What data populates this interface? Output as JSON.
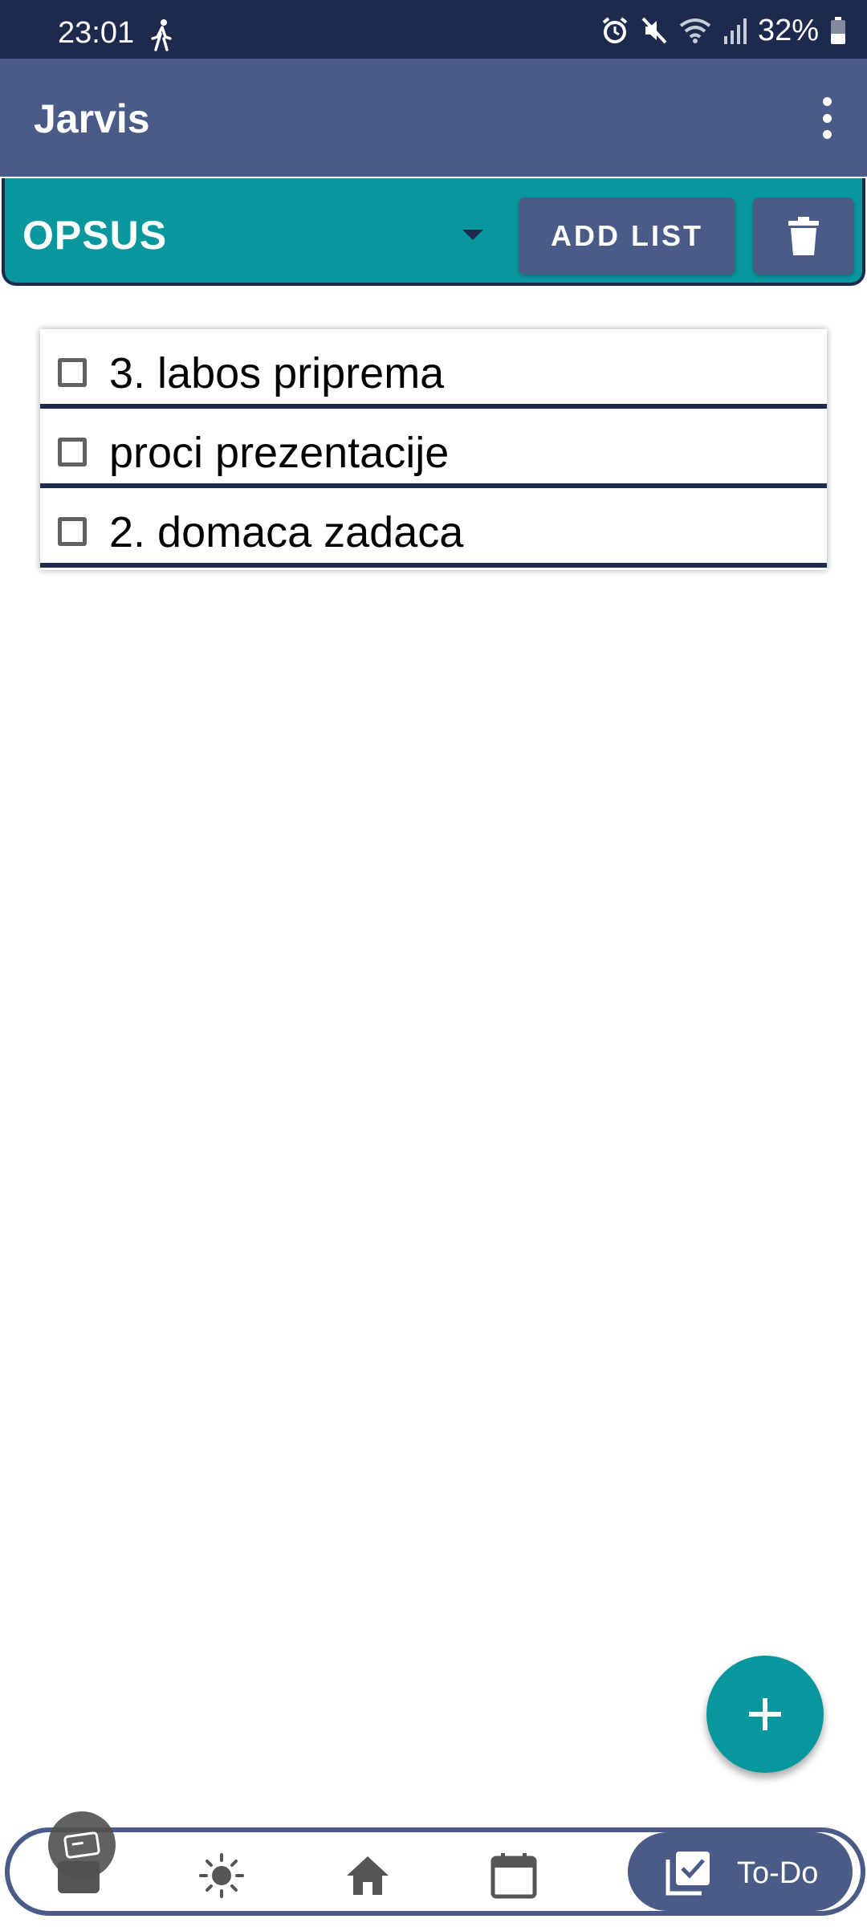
{
  "status": {
    "time": "23:01",
    "battery": "32%",
    "icons": [
      "walking-icon",
      "alarm-icon",
      "mute-icon",
      "wifi-icon",
      "signal-icon",
      "battery-icon"
    ]
  },
  "appbar": {
    "title": "Jarvis",
    "menu_icon": "more-vert-icon"
  },
  "listbar": {
    "selected_list": "OPSUS",
    "add_list_label": "ADD LIST",
    "delete_icon": "trash-icon"
  },
  "todos": [
    {
      "text": "3. labos priprema",
      "checked": false
    },
    {
      "text": "proci prezentacije",
      "checked": false
    },
    {
      "text": "2. domaca zadaca",
      "checked": false
    }
  ],
  "fab": {
    "icon": "plus-icon"
  },
  "bottomnav": {
    "items": [
      {
        "icon": "wallet-icon"
      },
      {
        "icon": "sun-icon"
      },
      {
        "icon": "home-icon"
      },
      {
        "icon": "calendar-icon"
      },
      {
        "icon": "todo-check-icon",
        "label": "To-Do",
        "active": true
      }
    ]
  },
  "colors": {
    "statusbar": "#1d2a4d",
    "primary": "#4a5b88",
    "accent": "#08979c"
  }
}
